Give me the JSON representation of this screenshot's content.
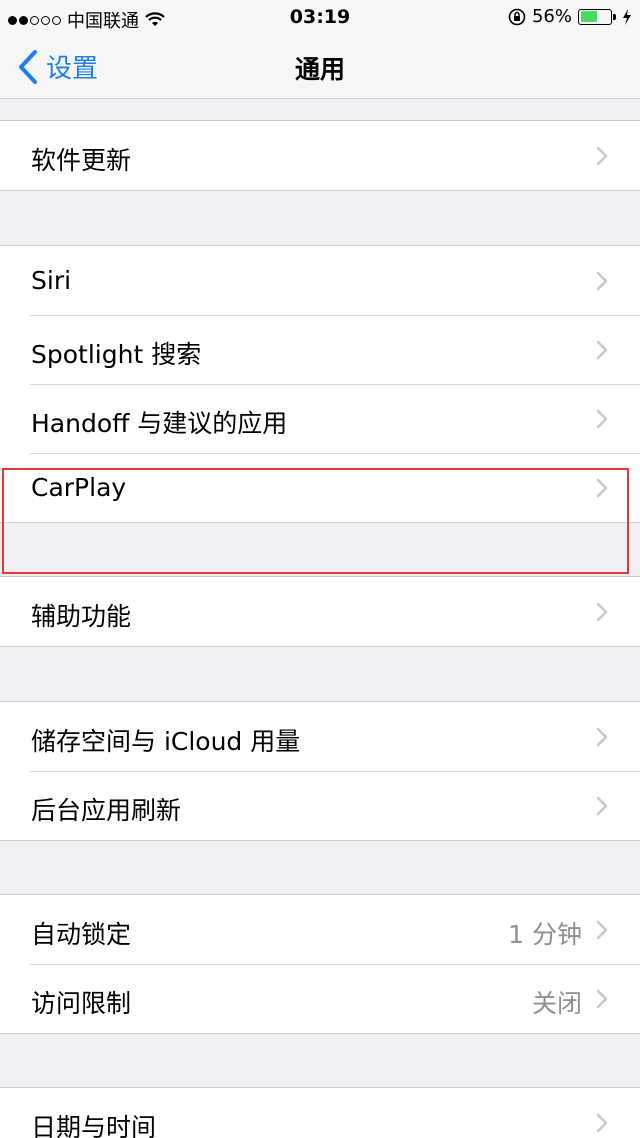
{
  "status_bar": {
    "carrier": "中国联通",
    "time": "03:19",
    "battery": "56%",
    "battery_level": 0.56,
    "icons": [
      "wifi-icon",
      "rotation-lock-icon",
      "charging-icon"
    ]
  },
  "nav": {
    "back_label": "设置",
    "title": "通用"
  },
  "groups": [
    {
      "items": [
        {
          "label": "软件更新",
          "value": ""
        }
      ]
    },
    {
      "items": [
        {
          "label": "Siri",
          "value": ""
        },
        {
          "label": "Spotlight 搜索",
          "value": ""
        },
        {
          "label": "Handoff 与建议的应用",
          "value": ""
        },
        {
          "label": "CarPlay",
          "value": ""
        }
      ]
    },
    {
      "items": [
        {
          "label": "辅助功能",
          "value": ""
        }
      ]
    },
    {
      "items": [
        {
          "label": "储存空间与 iCloud 用量",
          "value": ""
        },
        {
          "label": "后台应用刷新",
          "value": ""
        }
      ]
    },
    {
      "items": [
        {
          "label": "自动锁定",
          "value": "1 分钟"
        },
        {
          "label": "访问限制",
          "value": "关闭"
        }
      ]
    },
    {
      "items": [
        {
          "label": "日期与时间",
          "value": ""
        }
      ]
    }
  ],
  "colors": {
    "accent": "#1e7cf5",
    "highlight_box": "#e53935",
    "battery": "#4cd964"
  }
}
